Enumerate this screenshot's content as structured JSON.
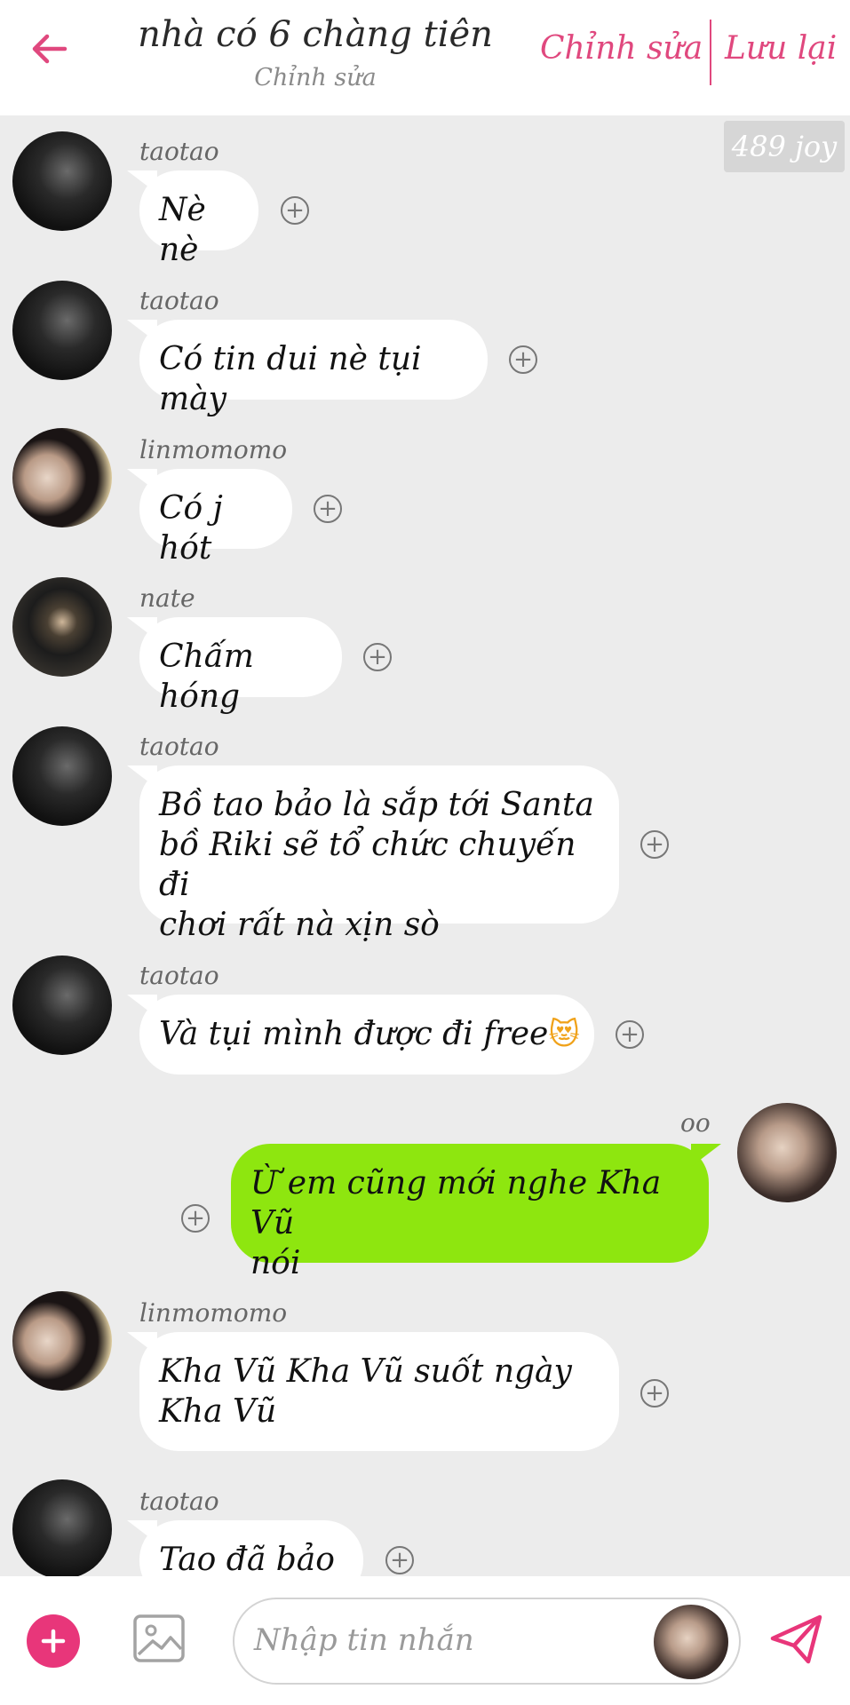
{
  "header": {
    "title": "nhà có 6 chàng tiên",
    "subtitle": "Chỉnh sửa",
    "edit_label": "Chỉnh sửa",
    "save_label": "Lưu lại",
    "accent_color": "#e0487e"
  },
  "badge": {
    "text": "489 joy"
  },
  "messages": [
    {
      "sender": "taotao",
      "text": "Nè nè",
      "direction": "incoming",
      "avatar": "taotao-avatar"
    },
    {
      "sender": "taotao",
      "text": "Có tin dui nè tụi mày",
      "direction": "incoming",
      "avatar": "taotao-avatar"
    },
    {
      "sender": "linmomomo",
      "text": "Có j hót",
      "direction": "incoming",
      "avatar": "linmomomo-avatar"
    },
    {
      "sender": "nate",
      "text": "Chấm hóng",
      "direction": "incoming",
      "avatar": "nate-avatar"
    },
    {
      "sender": "taotao",
      "lines": [
        "Bồ tao bảo là sắp tới Santa",
        "bồ Riki sẽ tổ chức chuyến đi",
        "chơi rất nà xịn sò"
      ],
      "direction": "incoming",
      "avatar": "taotao-avatar"
    },
    {
      "sender": "taotao",
      "text": "Và tụi mình được đi free",
      "emoji": "😻",
      "direction": "incoming",
      "avatar": "taotao-avatar"
    },
    {
      "sender": "oo",
      "lines": [
        "Ừ em cũng mới nghe Kha Vũ",
        "nói"
      ],
      "direction": "outgoing",
      "avatar": "oo-avatar"
    },
    {
      "sender": "linmomomo",
      "lines": [
        "Kha Vũ Kha Vũ suốt ngày",
        "Kha Vũ"
      ],
      "direction": "incoming",
      "avatar": "linmomomo-avatar"
    },
    {
      "sender": "taotao",
      "text": "Tao đã bảo r",
      "direction": "incoming",
      "avatar": "taotao-avatar"
    }
  ],
  "input": {
    "placeholder": "Nhập tin nhắn",
    "icons": [
      "plus-icon",
      "image-icon",
      "send-icon"
    ],
    "add_color": "#e8367a",
    "send_color": "#e8367a"
  },
  "colors": {
    "background": "#ececec",
    "incoming_bubble": "#ffffff",
    "outgoing_bubble": "#8ee60f"
  }
}
